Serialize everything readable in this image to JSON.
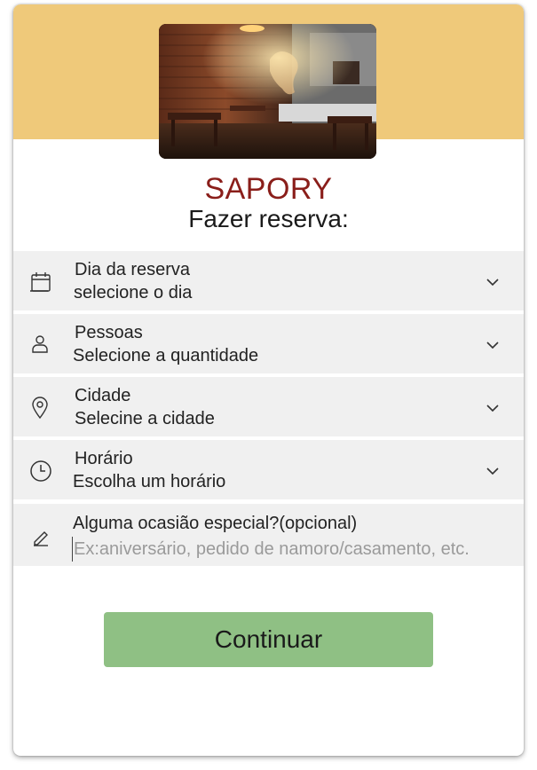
{
  "brand": {
    "name": "SAPORY"
  },
  "page": {
    "title": "Fazer reserva:"
  },
  "hero": {
    "image": "restaurant-interior"
  },
  "fields": [
    {
      "icon": "calendar-icon",
      "label": "Dia da reserva",
      "value": "selecione o dia"
    },
    {
      "icon": "person-icon",
      "label": "Pessoas",
      "value": "Selecione a quantidade"
    },
    {
      "icon": "location-pin-icon",
      "label": "Cidade",
      "value": "Selecine a cidade"
    },
    {
      "icon": "clock-icon",
      "label": "Horário",
      "value": "Escolha um horário"
    }
  ],
  "occasion": {
    "icon": "pencil-icon",
    "label": "Alguma ocasião especial?(opcional)",
    "placeholder": "Ex:aniversário, pedido de namoro/casamento, etc."
  },
  "actions": {
    "continue_label": "Continuar"
  },
  "colors": {
    "header": "#efc97a",
    "brand": "#8a1e1a",
    "field_bg": "#f0f0f0",
    "button": "#8fc084"
  }
}
